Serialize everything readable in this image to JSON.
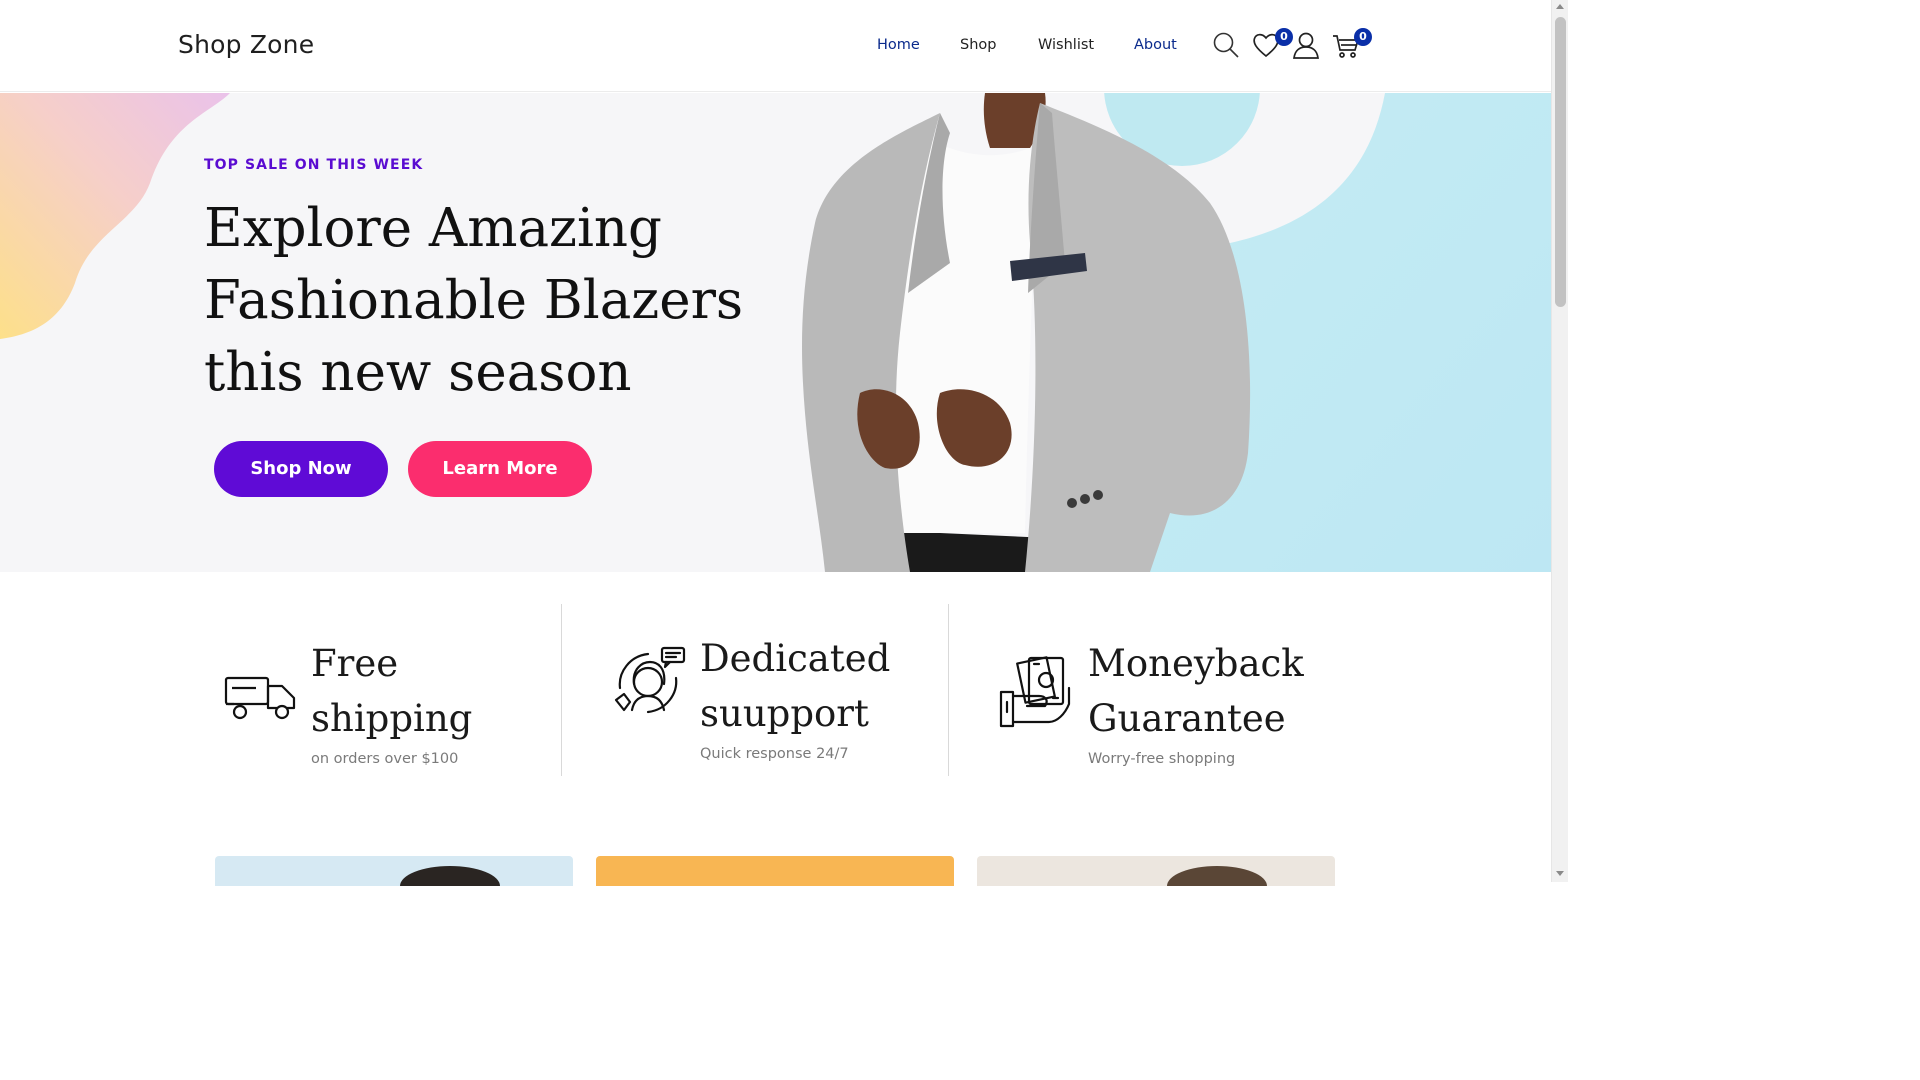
{
  "header": {
    "brand": "Shop Zone",
    "nav": [
      {
        "label": "Home",
        "active": true
      },
      {
        "label": "Shop",
        "active": false
      },
      {
        "label": "Wishlist",
        "active": false
      },
      {
        "label": "About",
        "active": true
      }
    ],
    "wishlist_count": "0",
    "cart_count": "0",
    "icons": [
      "search-icon",
      "heart-icon",
      "user-icon",
      "cart-icon"
    ]
  },
  "hero": {
    "eyebrow": "TOP SALE ON THIS WEEK",
    "headline_lines": [
      "Explore Amazing",
      "Fashionable Blazers",
      "this new season"
    ],
    "primary_button": "Shop Now",
    "secondary_button": "Learn More"
  },
  "features": [
    {
      "icon": "truck-icon",
      "title_lines": [
        "Free",
        "shipping"
      ],
      "subtitle": "on orders over $100"
    },
    {
      "icon": "support-agent-icon",
      "title_lines": [
        "Dedicated",
        "suupport"
      ],
      "subtitle": "Quick response 24/7"
    },
    {
      "icon": "money-hand-icon",
      "title_lines": [
        "Moneyback",
        "Guarantee"
      ],
      "subtitle": "Worry-free shopping"
    }
  ],
  "colors": {
    "accent_purple": "#5f0bd6",
    "accent_pink": "#fb2d6e",
    "nav_active": "#0a2a8c",
    "badge": "#0a2fa8"
  }
}
